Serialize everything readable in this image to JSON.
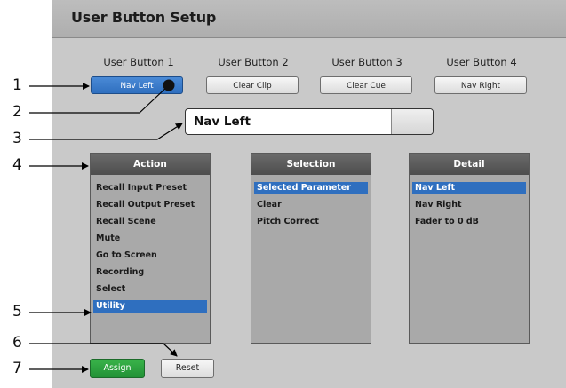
{
  "panel": {
    "title": "User Button Setup"
  },
  "user_buttons": [
    {
      "label": "User Button 1",
      "value": "Nav Left",
      "active": true
    },
    {
      "label": "User Button 2",
      "value": "Clear Clip",
      "active": false
    },
    {
      "label": "User Button 3",
      "value": "Clear Cue",
      "active": false
    },
    {
      "label": "User Button 4",
      "value": "Nav Right",
      "active": false
    }
  ],
  "display": {
    "text": "Nav Left"
  },
  "action": {
    "header": "Action",
    "items": [
      "Recall Input Preset",
      "Recall Output Preset",
      "Recall Scene",
      "Mute",
      "Go to Screen",
      "Recording",
      "Select",
      "Utility"
    ],
    "selected": "Utility"
  },
  "selection": {
    "header": "Selection",
    "items": [
      "Selected Parameter",
      "Clear",
      "Pitch Correct"
    ],
    "selected": "Selected Parameter"
  },
  "detail": {
    "header": "Detail",
    "items": [
      "Nav Left",
      "Nav Right",
      "Fader to 0 dB"
    ],
    "selected": "Nav Left"
  },
  "buttons": {
    "assign": "Assign",
    "reset": "Reset"
  },
  "callouts": [
    "1",
    "2",
    "3",
    "4",
    "5",
    "6",
    "7"
  ],
  "colors": {
    "selected_blue": "#2f6fbf",
    "assign_green": "#2aa53d",
    "panel_gray": "#c9c9c9"
  }
}
